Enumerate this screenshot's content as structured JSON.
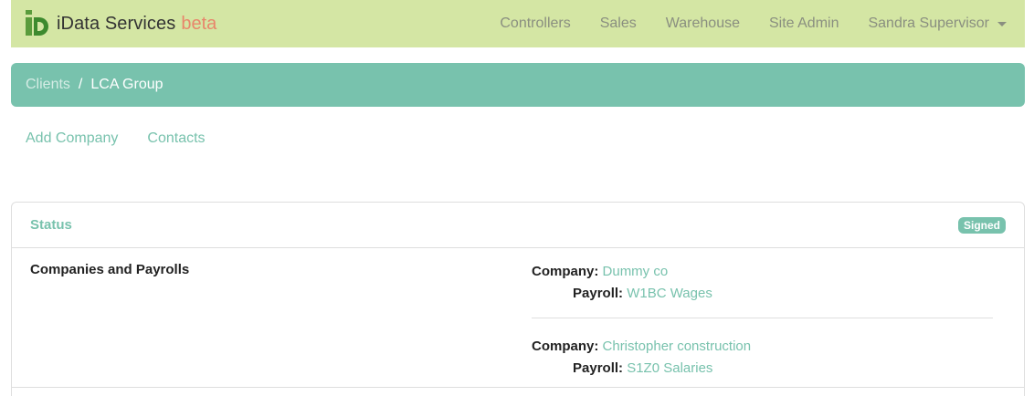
{
  "navbar": {
    "brand": "iData Services",
    "beta": "beta",
    "links": [
      "Controllers",
      "Sales",
      "Warehouse",
      "Site Admin"
    ],
    "user": "Sandra Supervisor"
  },
  "breadcrumb": {
    "parent": "Clients",
    "separator": "/",
    "current": "LCA Group"
  },
  "subnav": {
    "add_company": "Add Company",
    "contacts": "Contacts"
  },
  "card": {
    "title": "Status",
    "badge": "Signed",
    "row_label": "Companies and Payrolls",
    "company_label": "Company:",
    "payroll_label": "Payroll:",
    "entries": [
      {
        "company": "Dummy co",
        "payroll": "W1BC Wages"
      },
      {
        "company": "Christopher construction",
        "payroll": "S1Z0 Salaries"
      }
    ]
  },
  "colors": {
    "navbar_bg": "#d4e6a4",
    "accent": "#78c2ad",
    "beta": "#e8866b",
    "nav_text": "#8a8f80"
  }
}
